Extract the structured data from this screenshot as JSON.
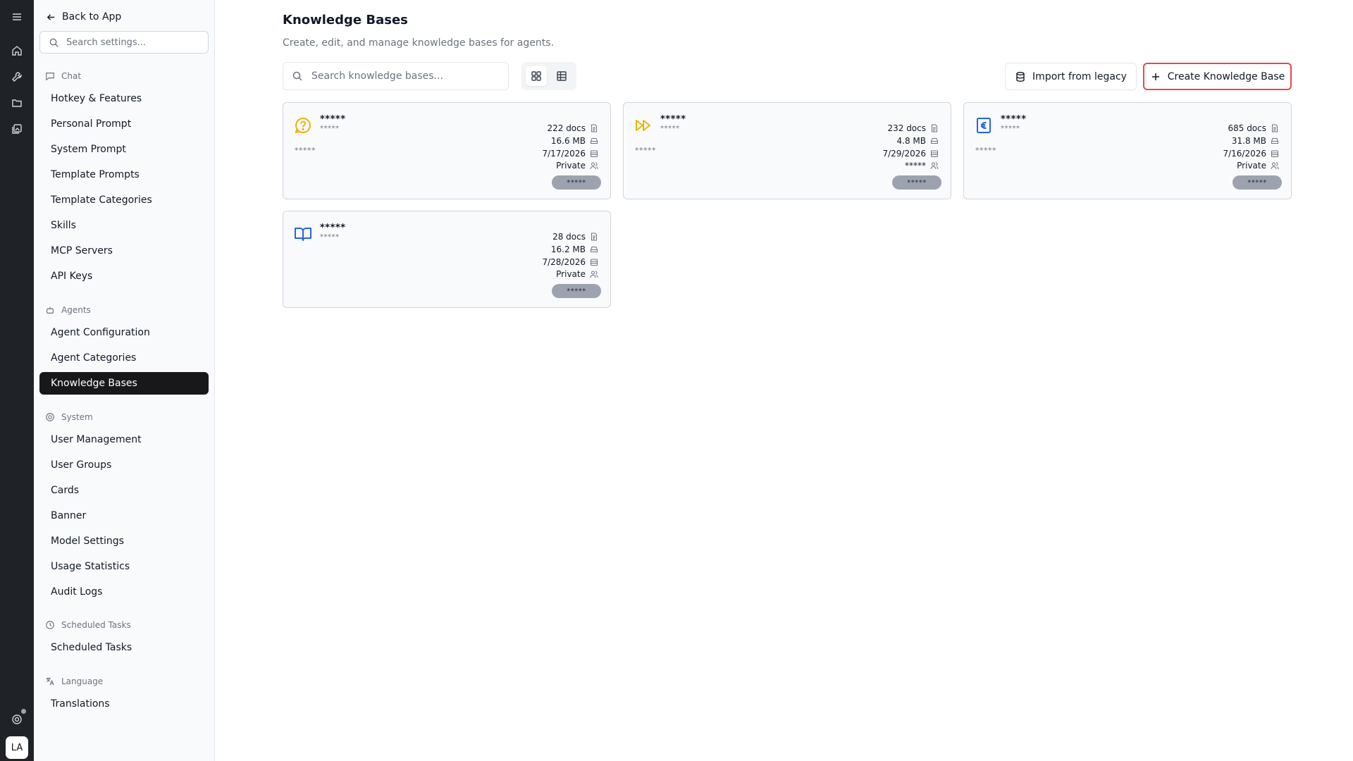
{
  "sidebar": {
    "back_label": "Back to App",
    "search_placeholder": "Search settings...",
    "sections": {
      "chat": "Chat",
      "agents": "Agents",
      "system": "System",
      "scheduled": "Scheduled Tasks",
      "language": "Language"
    },
    "items": {
      "hotkey": "Hotkey & Features",
      "personal_prompt": "Personal Prompt",
      "system_prompt": "System Prompt",
      "template_prompts": "Template Prompts",
      "template_categories": "Template Categories",
      "skills": "Skills",
      "mcp_servers": "MCP Servers",
      "api_keys": "API Keys",
      "agent_configuration": "Agent Configuration",
      "agent_categories": "Agent Categories",
      "knowledge_bases": "Knowledge Bases",
      "user_management": "User Management",
      "user_groups": "User Groups",
      "cards": "Cards",
      "banner": "Banner",
      "model_settings": "Model Settings",
      "usage_statistics": "Usage Statistics",
      "audit_logs": "Audit Logs",
      "scheduled_tasks": "Scheduled Tasks",
      "translations": "Translations"
    }
  },
  "user": {
    "initials": "LA"
  },
  "main": {
    "title": "Knowledge Bases",
    "subtitle": "Create, edit, and manage knowledge bases for agents.",
    "search_placeholder": "Search knowledge bases...",
    "import_label": "Import from legacy",
    "create_label": "Create Knowledge Base",
    "accent_color": "#e5484d"
  },
  "cards": [
    {
      "icon": "help-circle-icon",
      "icon_color": "#eab308",
      "name": "*****",
      "sub": "*****",
      "desc": "*****",
      "docs": "222 docs",
      "size": "16.6 MB",
      "date": "7/17/2026",
      "visibility": "Private",
      "tag": "*****"
    },
    {
      "icon": "fast-forward-icon",
      "icon_color": "#eab308",
      "name": "*****",
      "sub": "*****",
      "desc": "*****",
      "docs": "232 docs",
      "size": "4.8 MB",
      "date": "7/29/2026",
      "visibility": "*****",
      "tag": "*****"
    },
    {
      "icon": "euro-icon",
      "icon_color": "#2563eb",
      "name": "*****",
      "sub": "*****",
      "desc": "*****",
      "docs": "685 docs",
      "size": "31.8 MB",
      "date": "7/16/2026",
      "visibility": "Private",
      "tag": "*****"
    },
    {
      "icon": "book-open-icon",
      "icon_color": "#2563eb",
      "name": "*****",
      "sub": "*****",
      "desc": "",
      "docs": "28 docs",
      "size": "16.2 MB",
      "date": "7/28/2026",
      "visibility": "Private",
      "tag": "*****"
    }
  ]
}
